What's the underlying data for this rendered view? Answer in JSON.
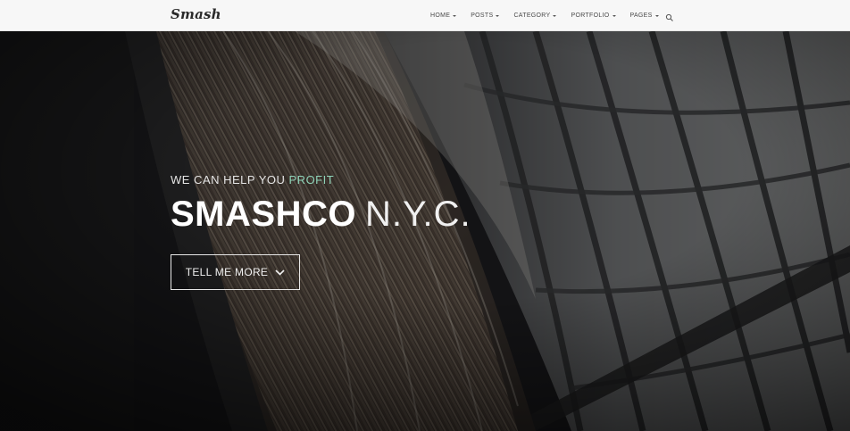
{
  "navbar": {
    "brand": "Smash",
    "menu": [
      {
        "label": "HOME"
      },
      {
        "label": "POSTS"
      },
      {
        "label": "CATEGORY"
      },
      {
        "label": "PORTFOLIO"
      },
      {
        "label": "PAGES"
      }
    ],
    "search_icon": "search-icon"
  },
  "hero": {
    "tagline_prefix": "WE CAN HELP YOU",
    "tagline_accent": "PROFIT",
    "title_bold": "SMASHCO",
    "title_light": "N.Y.C.",
    "cta_label": "TELL ME MORE",
    "cta_icon": "chevron-down-icon",
    "background": "library-bookshelves-photo"
  },
  "colors": {
    "accent": "#8fd3b8",
    "navbar_bg": "#f7f7f7",
    "hero_overlay": "#1b1b1d"
  }
}
